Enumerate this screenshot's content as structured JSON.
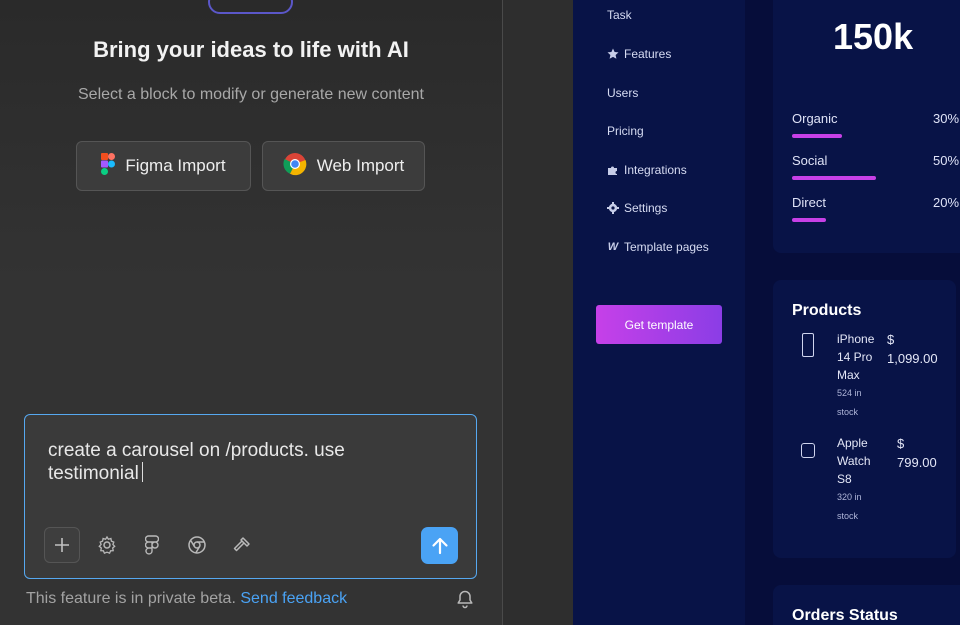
{
  "ai_panel": {
    "title": "Bring your ideas to life with AI",
    "subtitle": "Select a block to modify or generate new content",
    "imports": [
      {
        "label": "Figma Import",
        "icon": "figma-icon"
      },
      {
        "label": "Web Import",
        "icon": "chrome-icon"
      }
    ],
    "prompt": {
      "line1": "create a carousel on /products. use",
      "line2": "testimonial"
    },
    "toolbar_icons": [
      "plus-icon",
      "gear-icon",
      "figma-icon",
      "chrome-icon",
      "hammer-icon",
      "arrow-up-icon"
    ],
    "beta_text": "This feature is in private beta.",
    "feedback_link": "Send feedback",
    "accent": "#4aa3f5"
  },
  "preview": {
    "sidebar": {
      "items": [
        {
          "label": "Task",
          "icon": ""
        },
        {
          "label": "Features",
          "icon": "star-icon"
        },
        {
          "label": "Users",
          "icon": ""
        },
        {
          "label": "Pricing",
          "icon": ""
        },
        {
          "label": "Integrations",
          "icon": "puzzle-icon"
        },
        {
          "label": "Settings",
          "icon": "gear-icon"
        },
        {
          "label": "Template pages",
          "icon": "w-icon"
        }
      ],
      "cta": "Get template"
    },
    "traffic": {
      "total": "150k",
      "sources": [
        {
          "label": "Organic",
          "pct": "30%",
          "value": 0.3
        },
        {
          "label": "Social",
          "pct": "50%",
          "value": 0.5
        },
        {
          "label": "Direct",
          "pct": "20%",
          "value": 0.2
        }
      ]
    },
    "products": {
      "title": "Products",
      "items": [
        {
          "name_lines": [
            "iPhone",
            "14 Pro",
            "Max"
          ],
          "stock_lines": [
            "524 in",
            "stock"
          ],
          "currency": "$",
          "price": "1,099.00"
        },
        {
          "name_lines": [
            "Apple",
            "Watch",
            "S8"
          ],
          "stock_lines": [
            "320 in",
            "stock"
          ],
          "currency": "$",
          "price": "799.00"
        }
      ]
    },
    "orders": {
      "title": "Orders Status"
    },
    "colors": {
      "background": "#060d3a",
      "card": "#081347",
      "accent": "#c740e6"
    }
  }
}
